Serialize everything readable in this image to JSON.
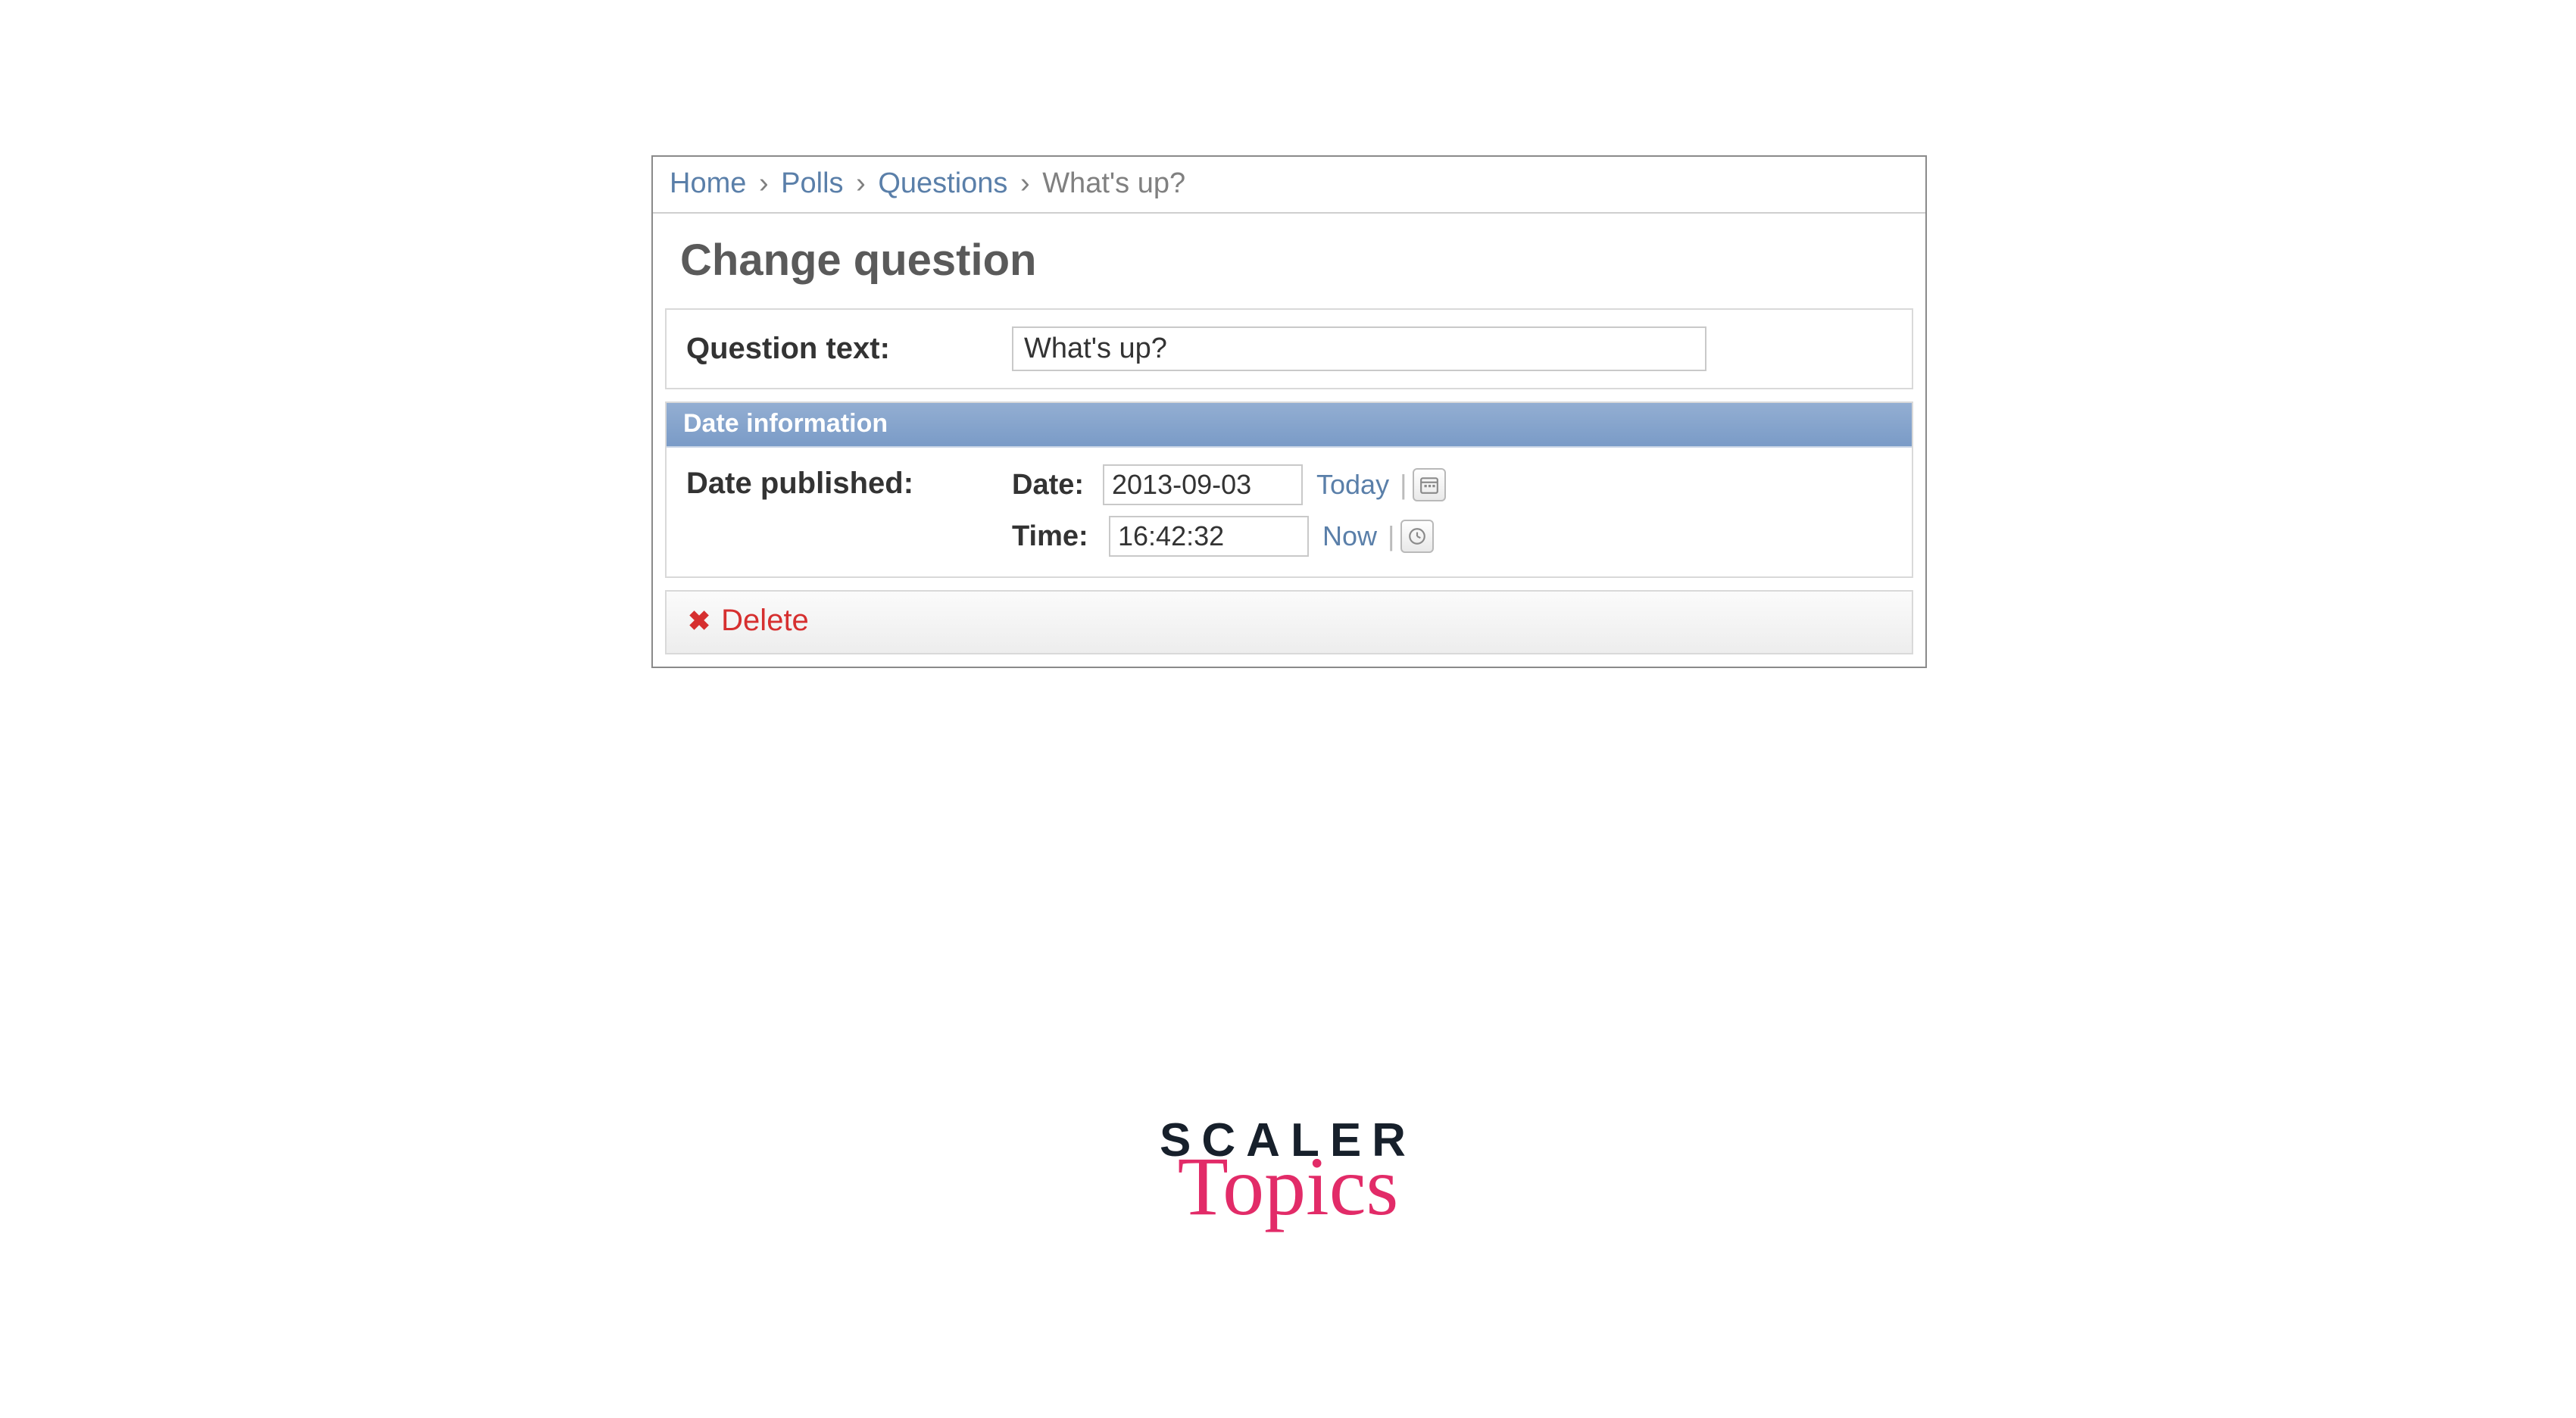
{
  "breadcrumb": {
    "home": "Home",
    "polls": "Polls",
    "questions": "Questions",
    "current": "What's up?"
  },
  "page": {
    "title": "Change question"
  },
  "form": {
    "question_text_label": "Question text:",
    "question_text_value": "What's up?",
    "fieldset_title": "Date information",
    "date_published_label": "Date published:",
    "date_label": "Date:",
    "date_value": "2013-09-03",
    "today_link": "Today",
    "time_label": "Time:",
    "time_value": "16:42:32",
    "now_link": "Now"
  },
  "actions": {
    "delete_label": "Delete"
  },
  "brand": {
    "top": "SCALER",
    "bottom": "Topics"
  }
}
